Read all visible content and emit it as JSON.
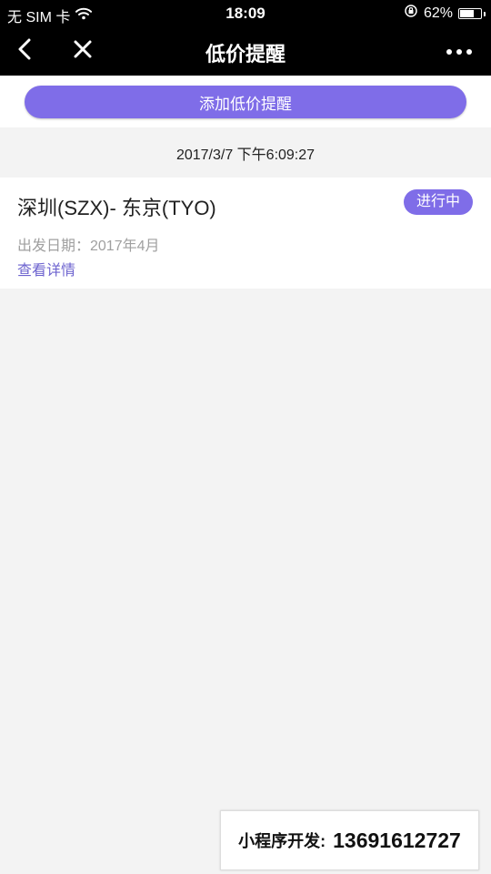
{
  "status_bar": {
    "carrier": "无 SIM 卡",
    "time": "18:09",
    "battery": "62%",
    "battery_level": 0.62
  },
  "nav": {
    "title": "低价提醒"
  },
  "add_button": {
    "label": "添加低价提醒"
  },
  "timestamp": "2017/3/7 下午6:09:27",
  "alert": {
    "route": "深圳(SZX)- 东京(TYO)",
    "status": "进行中",
    "departure": "出发日期：2017年4月",
    "details": "查看详情"
  },
  "contact": {
    "label": "小程序开发:",
    "phone": "13691612727"
  },
  "colors": {
    "accent": "#7f6de8",
    "link": "#6d63cf"
  },
  "icons": {
    "wifi": "wifi-icon",
    "orientation_lock": "orientation-lock-icon",
    "battery": "battery-icon",
    "back": "back-icon",
    "close": "close-icon",
    "more": "more-icon"
  }
}
